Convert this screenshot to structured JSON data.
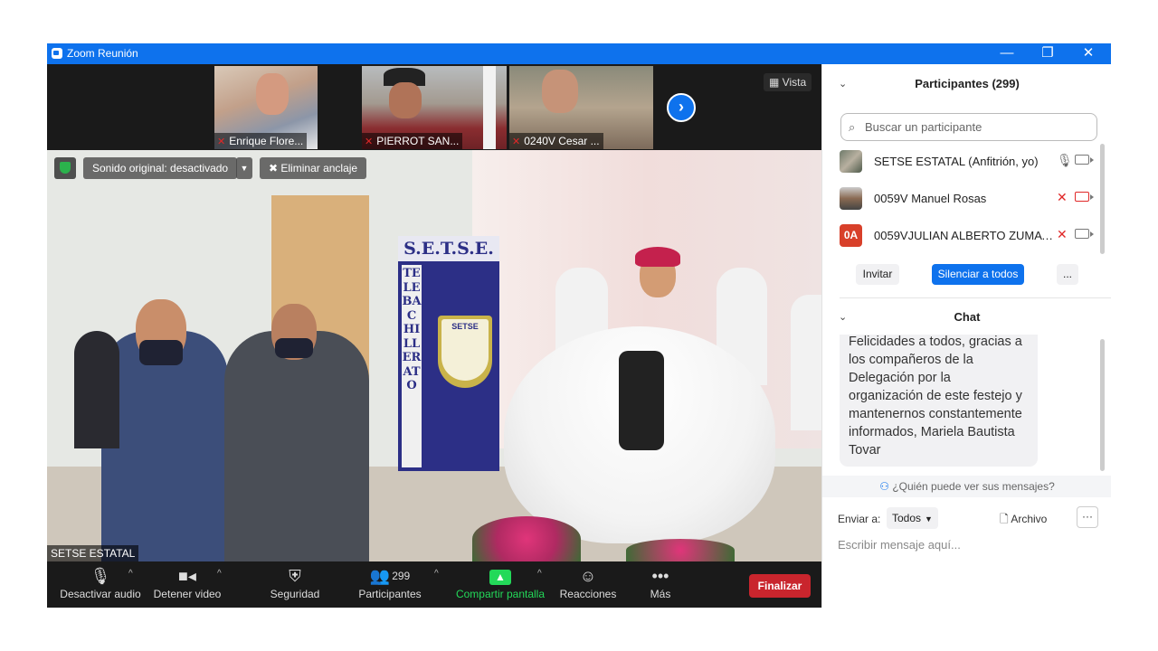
{
  "window": {
    "title": "Zoom Reunión",
    "min": "—",
    "restore": "❐",
    "close": "✕"
  },
  "strip": {
    "thumbs": [
      {
        "name": "Enrique Flore..."
      },
      {
        "name": "PIERROT SAN..."
      },
      {
        "name": "0240V Cesar ..."
      }
    ],
    "next": "›",
    "view_label": "Vista"
  },
  "main_video": {
    "sound_label": "Sonido original: desactivado",
    "unpin_label": "Eliminar anclaje",
    "speaker_name": "SETSE ESTATAL",
    "banner_title": "S.E.T.S.E.",
    "banner_side": "TELEBACHILLERATO",
    "banner_logo": "SETSE"
  },
  "toolbar": {
    "audio": "Desactivar audio",
    "video": "Detener video",
    "security": "Seguridad",
    "participants": "Participantes",
    "participants_count": "299",
    "share": "Compartir pantalla",
    "reactions": "Reacciones",
    "more": "Más",
    "end": "Finalizar"
  },
  "participants_panel": {
    "title": "Participantes (299)",
    "search_placeholder": "Buscar un participante",
    "rows": [
      {
        "name": "SETSE ESTATAL (Anfitrión, yo)",
        "initials": ""
      },
      {
        "name": "0059V Manuel Rosas",
        "initials": ""
      },
      {
        "name": "0059VJULIAN ALBERTO ZUMAYA...",
        "initials": "0A"
      }
    ],
    "invite": "Invitar",
    "mute_all": "Silenciar a todos",
    "more": "..."
  },
  "chat": {
    "title": "Chat",
    "message": "Felicidades a todos, gracias a los compañeros de la Delegación por la organización de este festejo y mantenernos constantemente informados, Mariela Bautista Tovar",
    "who_sees": "¿Quién puede ver sus mensajes?",
    "send_to_label": "Enviar a:",
    "send_to_value": "Todos",
    "file": "Archivo",
    "more": "···",
    "input_placeholder": "Escribir mensaje aquí..."
  },
  "colors": {
    "accent": "#0e72ed",
    "end": "#c9252d",
    "share": "#23d959",
    "mute": "#e02828"
  }
}
